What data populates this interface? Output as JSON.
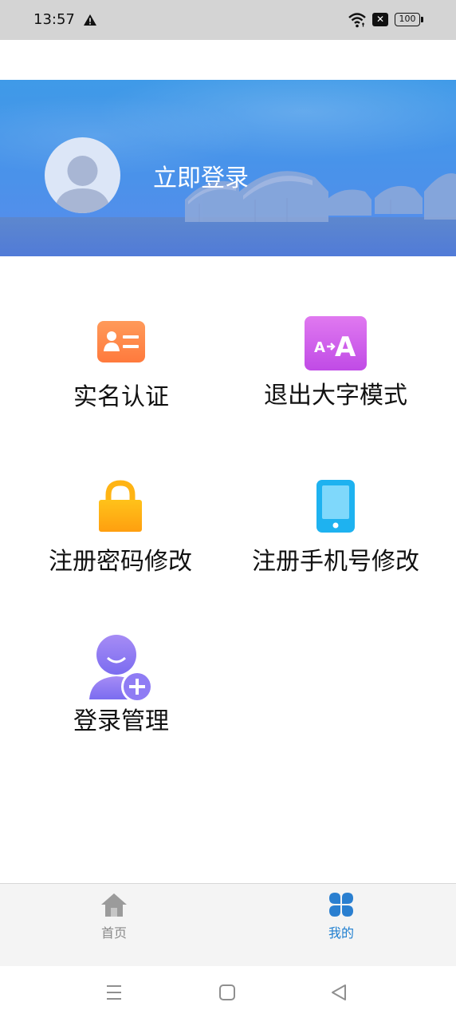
{
  "status_bar": {
    "time": "13:57",
    "battery": "100"
  },
  "profile": {
    "login_label": "立即登录"
  },
  "menu": {
    "real_name": "实名认证",
    "exit_large_font": "退出大字模式",
    "exit_large_font_icon_text": "A→A",
    "change_password": "注册密码修改",
    "change_phone": "注册手机号修改",
    "login_management": "登录管理"
  },
  "tabs": {
    "home": "首页",
    "mine": "我的",
    "active": "mine",
    "active_color": "#1f7fd0",
    "inactive_color": "#8a8a8a"
  },
  "icons": {
    "real_name": "id-card-icon",
    "exit_large_font": "font-size-icon",
    "change_password": "lock-icon",
    "change_phone": "phone-icon",
    "login_management": "add-user-icon",
    "home": "home-icon",
    "mine": "four-leaf-icon"
  }
}
